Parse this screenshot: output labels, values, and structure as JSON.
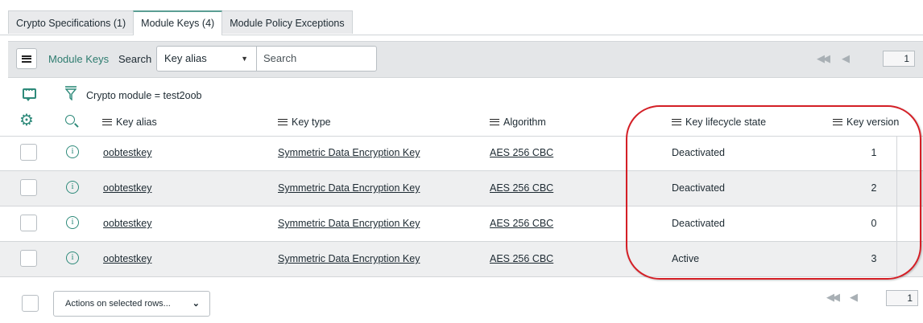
{
  "tabs": [
    {
      "label": "Crypto Specifications (1)"
    },
    {
      "label": "Module Keys (4)"
    },
    {
      "label": "Module Policy Exceptions"
    }
  ],
  "toolbar": {
    "title": "Module Keys",
    "search_label": "Search",
    "search_field": "Key alias",
    "search_placeholder": "Search",
    "page": "1"
  },
  "filter": {
    "text": "Crypto module = test2oob"
  },
  "columns": {
    "key_alias": "Key alias",
    "key_type": "Key type",
    "algorithm": "Algorithm",
    "key_lifecycle_state": "Key lifecycle state",
    "key_version": "Key version"
  },
  "rows": [
    {
      "key_alias": "oobtestkey",
      "key_type": "Symmetric Data Encryption Key",
      "algorithm": "AES 256 CBC",
      "state": "Deactivated",
      "version": "1"
    },
    {
      "key_alias": "oobtestkey",
      "key_type": "Symmetric Data Encryption Key",
      "algorithm": "AES 256 CBC",
      "state": "Deactivated",
      "version": "2"
    },
    {
      "key_alias": "oobtestkey",
      "key_type": "Symmetric Data Encryption Key",
      "algorithm": "AES 256 CBC",
      "state": "Deactivated",
      "version": "0"
    },
    {
      "key_alias": "oobtestkey",
      "key_type": "Symmetric Data Encryption Key",
      "algorithm": "AES 256 CBC",
      "state": "Active",
      "version": "3"
    }
  ],
  "footer": {
    "actions_label": "Actions on selected rows...",
    "page": "1"
  },
  "colors": {
    "accent": "#2e8a7a",
    "annotation": "#d41f26"
  }
}
